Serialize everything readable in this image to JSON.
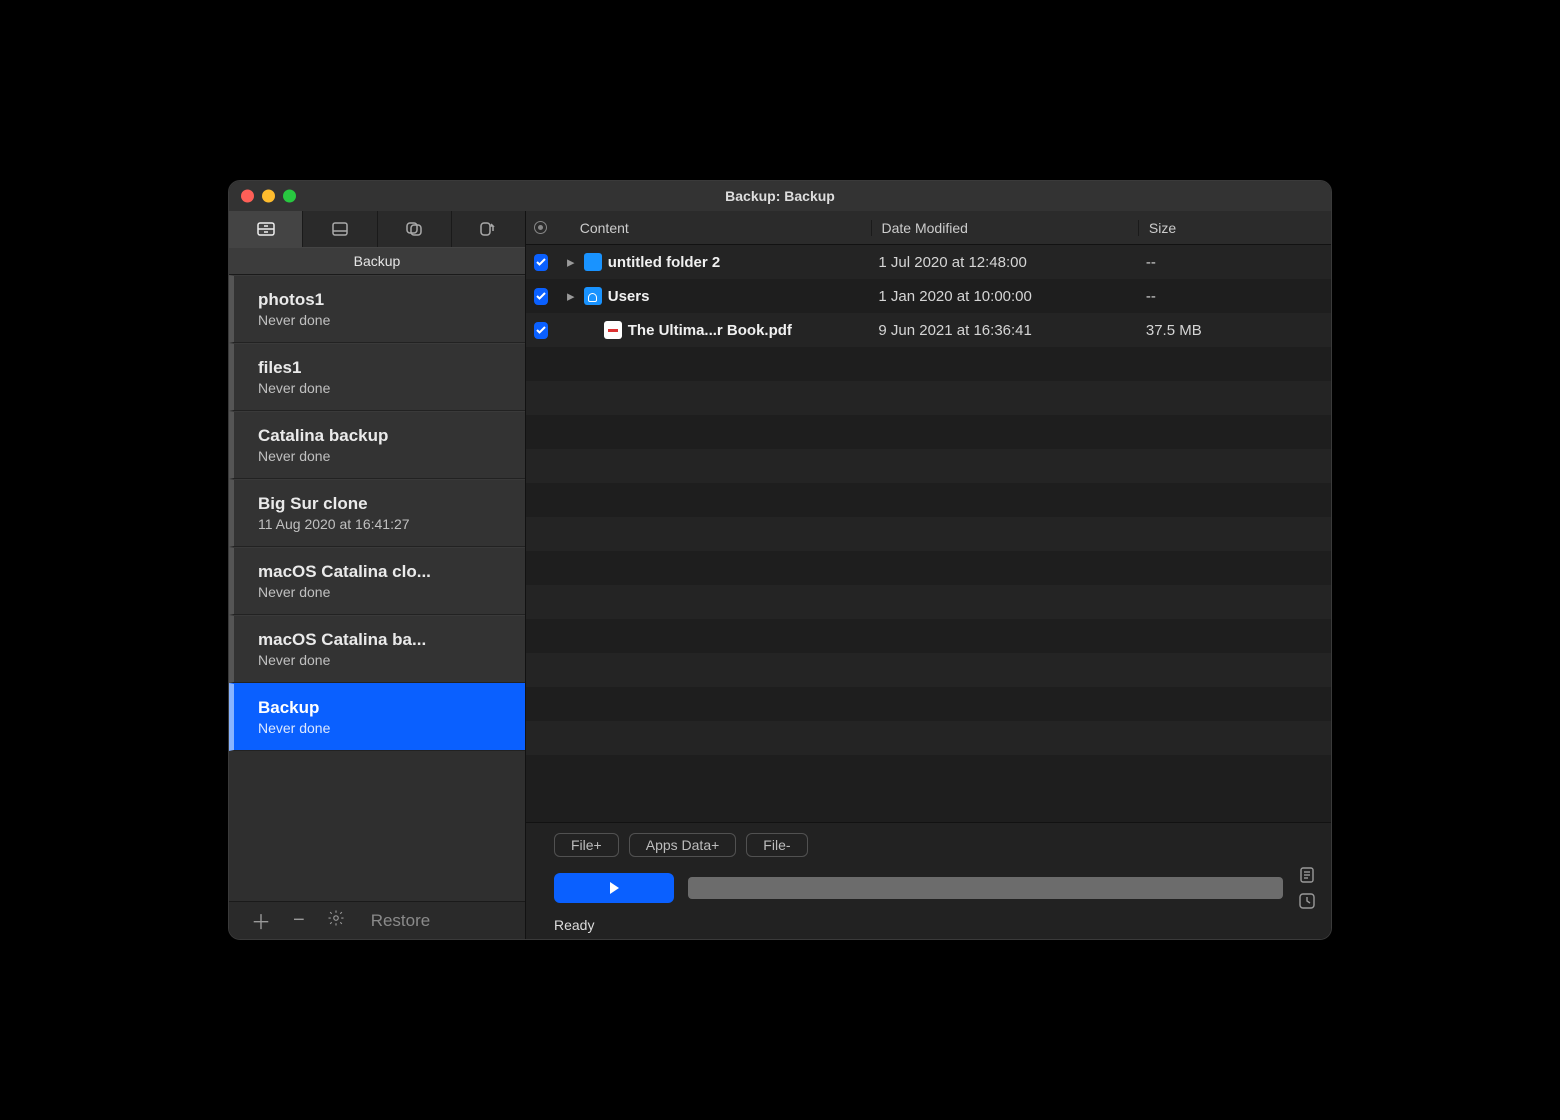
{
  "titlebar": {
    "title": "Backup: Backup"
  },
  "sidebar": {
    "header": "Backup",
    "items": [
      {
        "name": "photos1",
        "sub": "Never done"
      },
      {
        "name": "files1",
        "sub": "Never done"
      },
      {
        "name": "Catalina backup",
        "sub": "Never done"
      },
      {
        "name": "Big Sur clone",
        "sub": "11 Aug 2020 at 16:41:27"
      },
      {
        "name": "macOS Catalina clo...",
        "sub": "Never done"
      },
      {
        "name": "macOS Catalina ba...",
        "sub": "Never done"
      },
      {
        "name": "Backup",
        "sub": "Never done"
      }
    ],
    "footer": {
      "restore": "Restore"
    }
  },
  "columns": {
    "content": "Content",
    "date": "Date Modified",
    "size": "Size"
  },
  "rows": [
    {
      "checked": true,
      "expandable": true,
      "icon": "folder",
      "name": "untitled folder 2",
      "date": "1 Jul 2020 at 12:48:00",
      "size": "--"
    },
    {
      "checked": true,
      "expandable": true,
      "icon": "folder-users",
      "name": "Users",
      "date": "1 Jan 2020 at 10:00:00",
      "size": "--"
    },
    {
      "checked": true,
      "expandable": false,
      "icon": "pdf",
      "name": "The Ultima...r Book.pdf",
      "date": "9 Jun 2021 at 16:36:41",
      "size": "37.5 MB"
    }
  ],
  "actions": {
    "file_plus": "File+",
    "apps_data_plus": "Apps Data+",
    "file_minus": "File-"
  },
  "status": "Ready"
}
